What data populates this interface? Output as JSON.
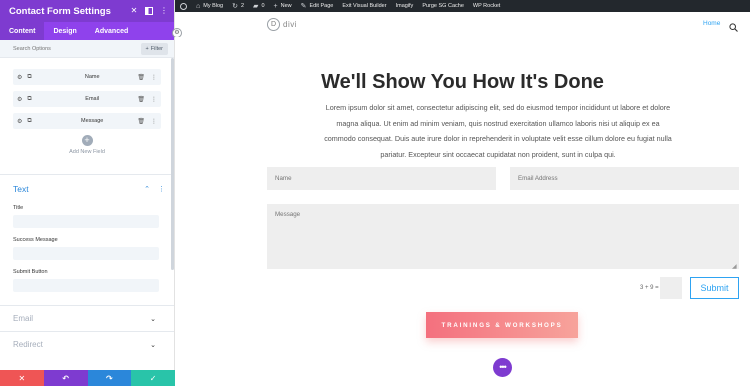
{
  "sidebar": {
    "title": "Contact Form Settings",
    "tabs": [
      {
        "label": "Content",
        "active": true
      },
      {
        "label": "Design",
        "active": false
      },
      {
        "label": "Advanced",
        "active": false
      }
    ],
    "search_placeholder": "Search Options",
    "filter_label": "Filter",
    "fields": [
      {
        "label": "Name"
      },
      {
        "label": "Email"
      },
      {
        "label": "Message"
      }
    ],
    "add_field_label": "Add New Field",
    "text_section": {
      "title": "Text",
      "options": [
        {
          "label": "Title",
          "value": ""
        },
        {
          "label": "Success Message",
          "value": ""
        },
        {
          "label": "Submit Button",
          "value": ""
        }
      ]
    },
    "collapsed_sections": [
      {
        "title": "Email"
      },
      {
        "title": "Redirect"
      }
    ],
    "footer_buttons": [
      {
        "name": "cancel",
        "glyph": "✕"
      },
      {
        "name": "undo",
        "glyph": "↶"
      },
      {
        "name": "redo",
        "glyph": "↷"
      },
      {
        "name": "save",
        "glyph": "✓"
      }
    ]
  },
  "adminbar": {
    "site_name": "My Blog",
    "updates_count": "2",
    "comments_count": "0",
    "new_label": "New",
    "edit_page_label": "Edit Page",
    "exit_builder_label": "Exit Visual Builder",
    "imagify_label": "Imagify",
    "purge_cache_label": "Purge SG Cache",
    "wp_rocket_label": "WP Rocket"
  },
  "site": {
    "logo_letter": "D",
    "logo_text": "divi",
    "nav_home": "Home"
  },
  "content": {
    "headline": "We'll Show You How It's Done",
    "body": "Lorem ipsum dolor sit amet, consectetur adipiscing elit, sed do eiusmod tempor incididunt ut labore et dolore magna aliqua. Ut enim ad minim veniam, quis nostrud exercitation ullamco laboris nisi ut aliquip ex ea commodo consequat. Duis aute irure dolor in reprehenderit in voluptate velit esse cillum dolore eu fugiat nulla pariatur. Excepteur sint occaecat cupidatat non proident, sunt in culpa qui.",
    "form": {
      "name_placeholder": "Name",
      "email_placeholder": "Email Address",
      "message_placeholder": "Message",
      "captcha": "3 + 9 =",
      "submit_label": "Submit"
    },
    "cta_label": "TRAININGS & WORKSHOPS",
    "more_glyph": "•••"
  },
  "colors": {
    "divi_purple": "#7e3bd0",
    "divi_blue": "#2b87da",
    "link_blue": "#2ea3f2",
    "cancel_red": "#ef5555",
    "save_green": "#29c4a9",
    "cta_start": "#f4707e",
    "cta_end": "#f7a39b"
  }
}
